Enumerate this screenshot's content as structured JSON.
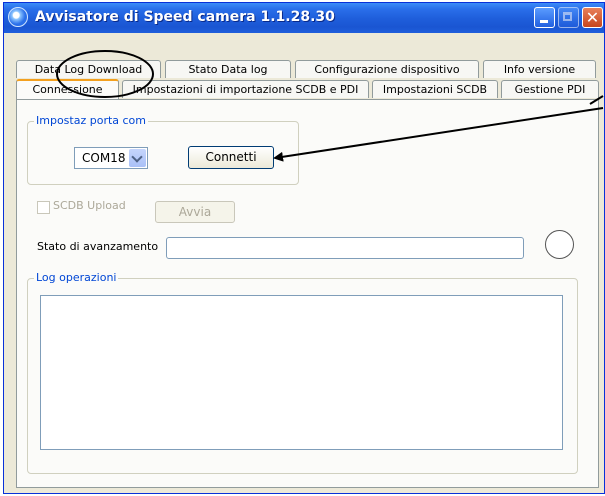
{
  "window": {
    "title": "Avvisatore di Speed camera  1.1.28.30",
    "controls": {
      "minimize": "minimize-icon",
      "maximize": "maximize-icon",
      "close": "close-icon"
    }
  },
  "tabs": {
    "row1": [
      "Data Log Download",
      "Stato Data log",
      "Configurazione dispositivo",
      "Info versione"
    ],
    "row2": [
      "Connessione",
      "Impostazioni di importazione SCDB e PDI",
      "Impostazioni SCDB",
      "Gestione PDI"
    ],
    "active": "Connessione"
  },
  "port_group": {
    "label": "Impostaz  porta com",
    "port_value": "COM18",
    "connect_label": "Connetti"
  },
  "scdb": {
    "checkbox_label": "SCDB Upload",
    "checked": false,
    "start_label": "Avvia"
  },
  "progress": {
    "label": "Stato di avanzamento",
    "value": ""
  },
  "log": {
    "label": "Log operazioni",
    "content": ""
  },
  "colors": {
    "titlebar": "#1f5fdc",
    "active_tab_accent": "#f3a01f",
    "group_label": "#0046d5",
    "window_bg": "#ece9d8"
  }
}
